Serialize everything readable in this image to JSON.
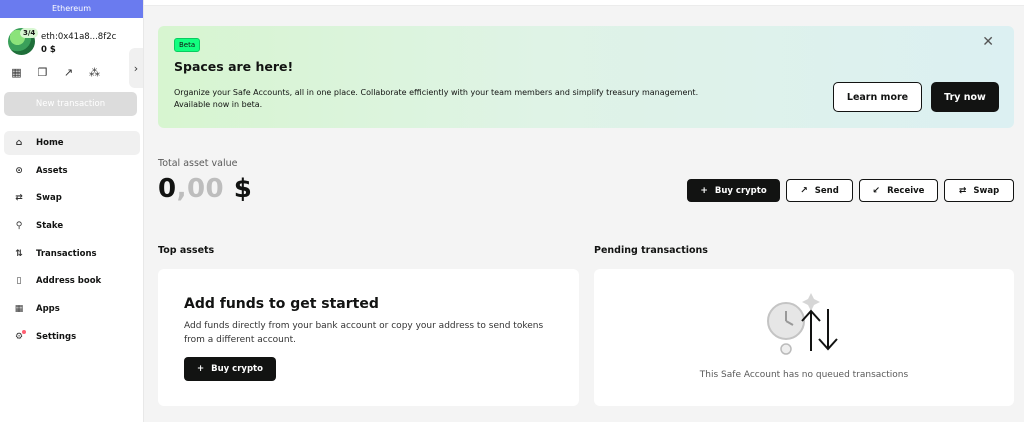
{
  "sidebar": {
    "chain": "Ethereum",
    "threshold": "3/4",
    "address": "eth:0x41a8...8f2c",
    "balance": "0 $",
    "new_tx": "New transaction",
    "items": [
      {
        "label": "Home",
        "icon": "home-icon",
        "glyph": "⌂"
      },
      {
        "label": "Assets",
        "icon": "assets-icon",
        "glyph": "⊙"
      },
      {
        "label": "Swap",
        "icon": "swap-icon",
        "glyph": "⇄"
      },
      {
        "label": "Stake",
        "icon": "stake-icon",
        "glyph": "⚲"
      },
      {
        "label": "Transactions",
        "icon": "transactions-icon",
        "glyph": "⇅"
      },
      {
        "label": "Address book",
        "icon": "address-book-icon",
        "glyph": "▯"
      },
      {
        "label": "Apps",
        "icon": "apps-icon",
        "glyph": "▦"
      },
      {
        "label": "Settings",
        "icon": "settings-icon",
        "glyph": "⚙"
      }
    ]
  },
  "banner": {
    "badge": "Beta",
    "title": "Spaces are here!",
    "desc": "Organize your Safe Accounts, all in one place. Collaborate efficiently with your team members and simplify treasury management. Available now in beta.",
    "learn_more": "Learn more",
    "try_now": "Try now"
  },
  "overview": {
    "label": "Total asset value",
    "value_main": "0",
    "value_decimals": ",00",
    "currency": " $",
    "buttons": [
      {
        "label": "Buy crypto",
        "glyph": "+"
      },
      {
        "label": "Send",
        "glyph": "↗"
      },
      {
        "label": "Receive",
        "glyph": "↙"
      },
      {
        "label": "Swap",
        "glyph": "⇄"
      }
    ]
  },
  "top_assets": {
    "title": "Top assets",
    "card_title": "Add funds to get started",
    "card_desc": "Add funds directly from your bank account or copy your address to send tokens from a different account.",
    "buy_label": "Buy crypto"
  },
  "pending": {
    "title": "Pending transactions",
    "empty": "This Safe Account has no queued transactions"
  },
  "colors": {
    "chain": "#6a7bef",
    "beta_badge": "#12ff80",
    "primary": "#121312"
  }
}
